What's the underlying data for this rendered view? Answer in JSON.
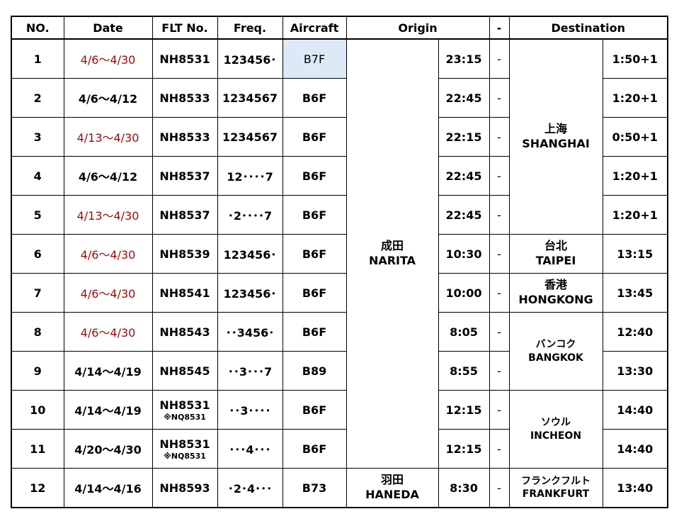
{
  "headers": {
    "no": "NO.",
    "date": "Date",
    "flt": "FLT No.",
    "freq": "Freq.",
    "aircraft": "Aircraft",
    "origin": "Origin",
    "dash": "-",
    "destination": "Destination"
  },
  "rows": [
    {
      "no": "1",
      "date": "4/6～4/30",
      "flt": "NH8531",
      "flt_sub": "",
      "freq": "123456･",
      "aircraft": "B7F",
      "dep": "23:15",
      "dash": "-",
      "arr": "1:50+1"
    },
    {
      "no": "2",
      "date": "4/6～4/12",
      "flt": "NH8533",
      "flt_sub": "",
      "freq": "1234567",
      "aircraft": "B6F",
      "dep": "22:45",
      "dash": "-",
      "arr": "1:20+1"
    },
    {
      "no": "3",
      "date": "4/13～4/30",
      "flt": "NH8533",
      "flt_sub": "",
      "freq": "1234567",
      "aircraft": "B6F",
      "dep": "22:15",
      "dash": "-",
      "arr": "0:50+1"
    },
    {
      "no": "4",
      "date": "4/6～4/12",
      "flt": "NH8537",
      "flt_sub": "",
      "freq": "12････7",
      "aircraft": "B6F",
      "dep": "22:45",
      "dash": "-",
      "arr": "1:20+1"
    },
    {
      "no": "5",
      "date": "4/13～4/30",
      "flt": "NH8537",
      "flt_sub": "",
      "freq": "･2････7",
      "aircraft": "B6F",
      "dep": "22:45",
      "dash": "-",
      "arr": "1:20+1"
    },
    {
      "no": "6",
      "date": "4/6～4/30",
      "flt": "NH8539",
      "flt_sub": "",
      "freq": "123456･",
      "aircraft": "B6F",
      "dep": "10:30",
      "dash": "-",
      "arr": "13:15"
    },
    {
      "no": "7",
      "date": "4/6～4/30",
      "flt": "NH8541",
      "flt_sub": "",
      "freq": "123456･",
      "aircraft": "B6F",
      "dep": "10:00",
      "dash": "-",
      "arr": "13:45"
    },
    {
      "no": "8",
      "date": "4/6～4/30",
      "flt": "NH8543",
      "flt_sub": "",
      "freq": "･･3456･",
      "aircraft": "B6F",
      "dep": "8:05",
      "dash": "-",
      "arr": "12:40"
    },
    {
      "no": "9",
      "date": "4/14～4/19",
      "flt": "NH8545",
      "flt_sub": "",
      "freq": "･･3･･･7",
      "aircraft": "B89",
      "dep": "8:55",
      "dash": "-",
      "arr": "13:30"
    },
    {
      "no": "10",
      "date": "4/14～4/19",
      "flt": "NH8531",
      "flt_sub": "※NQ8531",
      "freq": "･･3････",
      "aircraft": "B6F",
      "dep": "12:15",
      "dash": "-",
      "arr": "14:40"
    },
    {
      "no": "11",
      "date": "4/20～4/30",
      "flt": "NH8531",
      "flt_sub": "※NQ8531",
      "freq": "･･･4･･･",
      "aircraft": "B6F",
      "dep": "12:15",
      "dash": "-",
      "arr": "14:40"
    },
    {
      "no": "12",
      "date": "4/14～4/16",
      "flt": "NH8593",
      "flt_sub": "",
      "freq": "･2･4･･･",
      "aircraft": "B73",
      "dep": "8:30",
      "dash": "-",
      "arr": "13:40"
    }
  ],
  "origins": {
    "narita": {
      "jp": "成田",
      "en": "NARITA"
    },
    "haneda": {
      "jp": "羽田",
      "en": "HANEDA"
    }
  },
  "destinations": {
    "shanghai": {
      "jp": "上海",
      "en": "SHANGHAI"
    },
    "taipei": {
      "jp": "台北",
      "en": "TAIPEI"
    },
    "hongkong": {
      "jp": "香港",
      "en": "HONGKONG"
    },
    "bangkok": {
      "jp": "バンコク",
      "en": "BANGKOK"
    },
    "incheon": {
      "jp": "ソウル",
      "en": "INCHEON"
    },
    "frankfurt": {
      "jp": "フランクフルト",
      "en": "FRANKFURT"
    }
  },
  "colors": {
    "date_highlight": "#9b0a0a",
    "aircraft_highlight_bg": "#dce9f6"
  }
}
